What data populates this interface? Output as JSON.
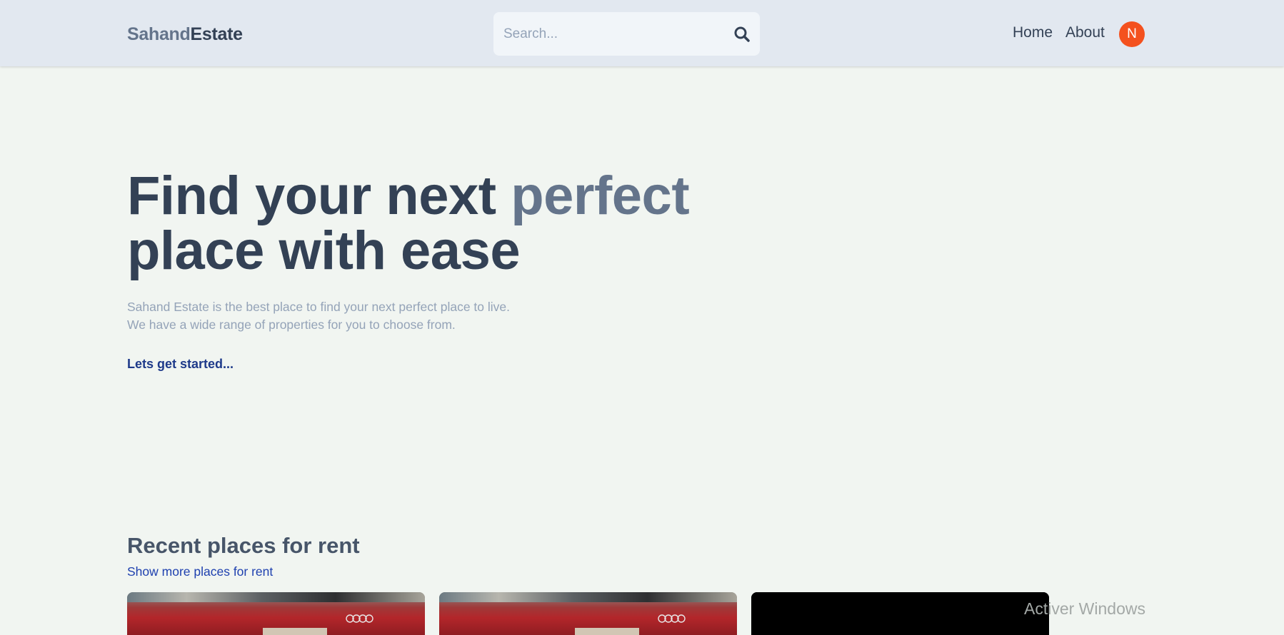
{
  "header": {
    "logo_part1": "Sahand",
    "logo_part2": "Estate",
    "search": {
      "placeholder": "Search...",
      "value": ""
    },
    "nav": {
      "home": "Home",
      "about": "About"
    },
    "avatar_initial": "N"
  },
  "hero": {
    "title_line1_start": "Find your next ",
    "title_accent": "perfect",
    "title_line2": "place with ease",
    "description_line1": "Sahand Estate is the best place to find your next perfect place to live.",
    "description_line2": "We have a wide range of properties for you to choose from.",
    "cta": "Lets get started..."
  },
  "recent_rent": {
    "title": "Recent places for rent",
    "show_more": "Show more places for rent"
  },
  "watermark": "Activer Windows",
  "colors": {
    "navbar_bg": "#e2e8f0",
    "page_bg": "#f1f5f1",
    "primary_text": "#334155",
    "accent_text": "#64748b",
    "muted_text": "#94a3b8",
    "link_blue": "#1e3a8a",
    "avatar_bg": "#f4511e"
  },
  "icons": {
    "search": "search-icon"
  }
}
